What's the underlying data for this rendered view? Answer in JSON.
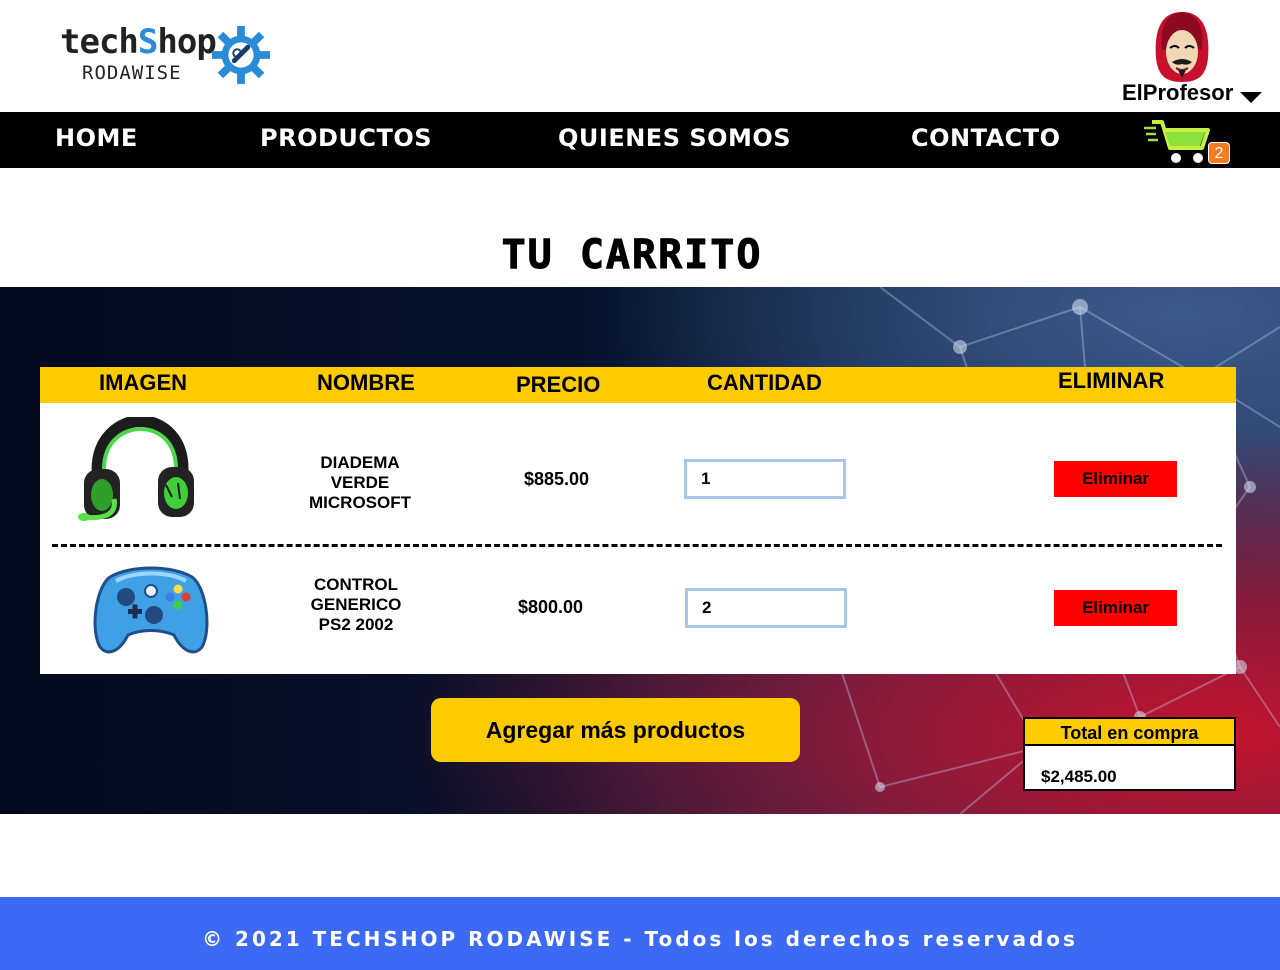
{
  "brand": {
    "logo_part1": "tech",
    "logo_part2": "S",
    "logo_part3": "hop",
    "logo_sub": "RODAWISE",
    "accent": "#2a8cd8"
  },
  "user": {
    "name": "ElProfesor"
  },
  "nav": {
    "items": [
      "HOME",
      "PRODUCTOS",
      "QUIENES SOMOS",
      "CONTACTO"
    ],
    "cart_count": "2"
  },
  "page": {
    "title": "TU CARRITO"
  },
  "table": {
    "headers": [
      "IMAGEN",
      "NOMBRE",
      "PRECIO",
      "CANTIDAD",
      "ELIMINAR"
    ],
    "rows": [
      {
        "name_lines": [
          "DIADEMA",
          "VERDE",
          "MICROSOFT"
        ],
        "price": "$885.00",
        "qty": "1",
        "delete_label": "Eliminar",
        "image_icon": "headset-icon"
      },
      {
        "name_lines": [
          "CONTROL",
          "GENERICO",
          "PS2 2002"
        ],
        "price": "$800.00",
        "qty": "2",
        "delete_label": "Eliminar",
        "image_icon": "gamepad-icon"
      }
    ]
  },
  "actions": {
    "add_more_label": "Agregar más productos"
  },
  "summary": {
    "total_label": "Total en compra",
    "total_value": "$2,485.00"
  },
  "footer": {
    "text": "© 2021 TECHSHOP RODAWISE - Todos los derechos reservados"
  },
  "colors": {
    "header_bar": "#000000",
    "table_header": "#fecb00",
    "delete_button": "#ff0000",
    "footer": "#3d6af5"
  }
}
